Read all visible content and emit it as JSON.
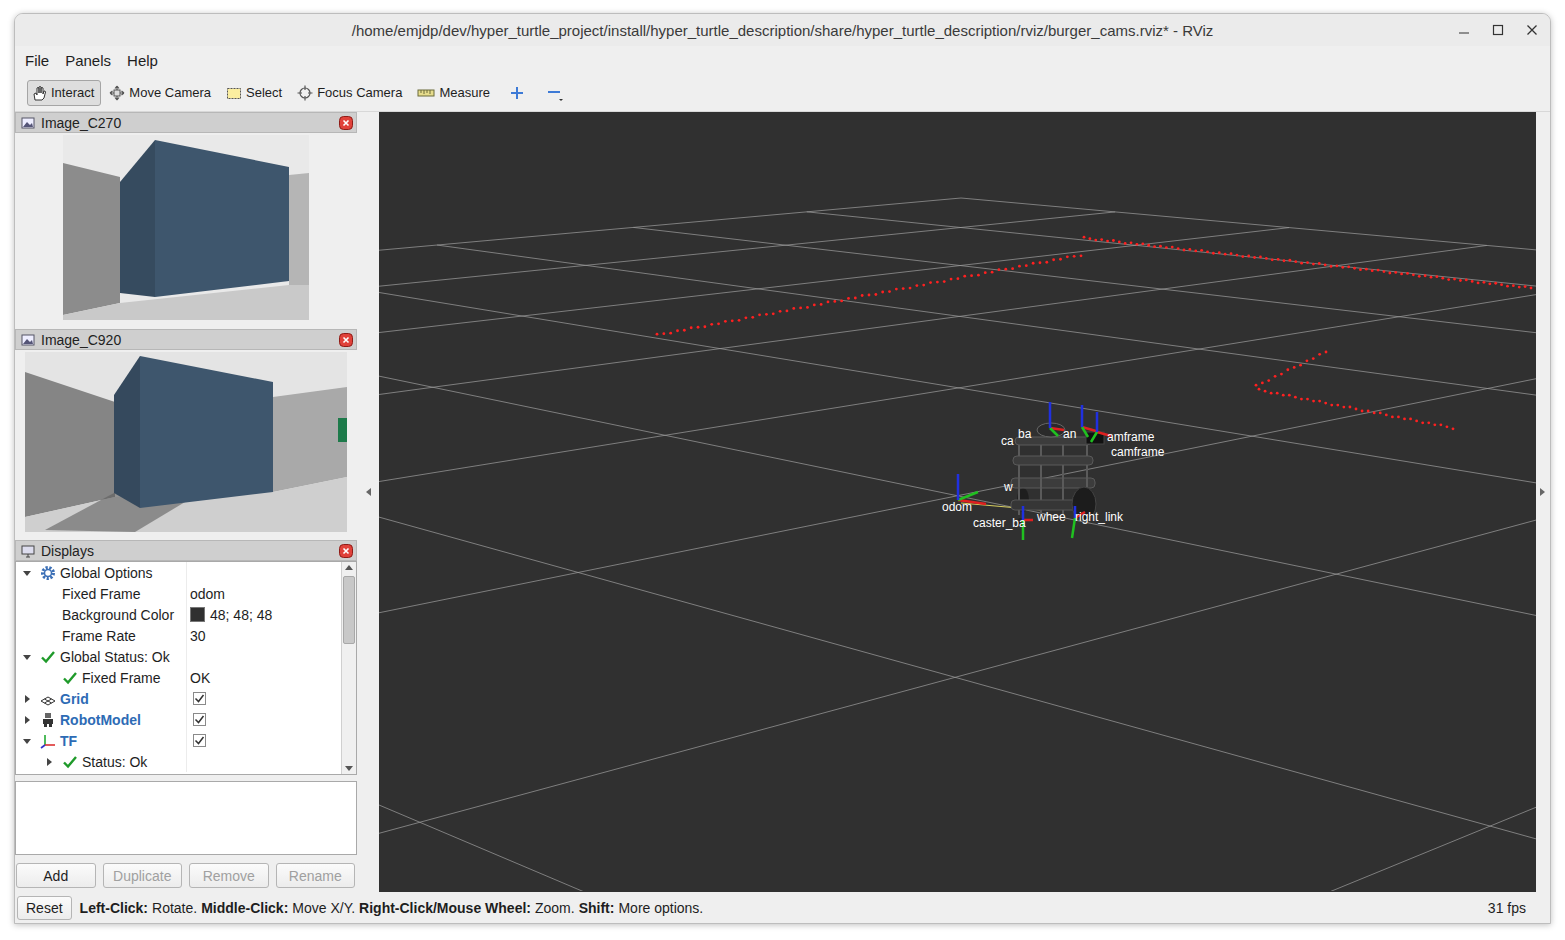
{
  "window": {
    "title": "/home/emjdp/dev/hyper_turtle_project/install/hyper_turtle_description/share/hyper_turtle_description/rviz/burger_cams.rviz* - RViz"
  },
  "menu": [
    "File",
    "Panels",
    "Help"
  ],
  "toolbar": [
    {
      "label": "Interact",
      "selected": true
    },
    {
      "label": "Move Camera",
      "selected": false
    },
    {
      "label": "Select",
      "selected": false
    },
    {
      "label": "Focus Camera",
      "selected": false
    },
    {
      "label": "Measure",
      "selected": false
    }
  ],
  "image_panels": [
    {
      "title": "Image_C270"
    },
    {
      "title": "Image_C920"
    }
  ],
  "displays": {
    "title": "Displays",
    "rows": [
      {
        "label": "Global Options",
        "kind": "options",
        "depth": 0,
        "expandable": true,
        "expanded": true,
        "value": ""
      },
      {
        "label": "Fixed Frame",
        "kind": "property",
        "depth": 1,
        "expandable": false,
        "expanded": false,
        "value": "odom"
      },
      {
        "label": "Background Color",
        "kind": "color",
        "depth": 1,
        "expandable": false,
        "expanded": false,
        "value": "48; 48; 48",
        "swatch": "#303030"
      },
      {
        "label": "Frame Rate",
        "kind": "property",
        "depth": 1,
        "expandable": false,
        "expanded": false,
        "value": "30"
      },
      {
        "label": "Global Status: Ok",
        "kind": "status",
        "depth": 0,
        "expandable": true,
        "expanded": true,
        "value": "",
        "ok": true
      },
      {
        "label": "Fixed Frame",
        "kind": "status",
        "depth": 1,
        "expandable": false,
        "expanded": false,
        "value": "OK",
        "ok": true
      },
      {
        "label": "Grid",
        "kind": "grid",
        "depth": 0,
        "expandable": true,
        "expanded": false,
        "value": "",
        "checked": true
      },
      {
        "label": "RobotModel",
        "kind": "robot-model",
        "depth": 0,
        "expandable": true,
        "expanded": false,
        "value": "",
        "checked": true
      },
      {
        "label": "TF",
        "kind": "tf",
        "depth": 0,
        "expandable": true,
        "expanded": true,
        "value": "",
        "checked": true
      },
      {
        "label": "Status: Ok",
        "kind": "status",
        "depth": 1,
        "expandable": true,
        "expanded": false,
        "value": "",
        "ok": true
      }
    ]
  },
  "buttons": [
    {
      "label": "Add",
      "disabled": false
    },
    {
      "label": "Duplicate",
      "disabled": true
    },
    {
      "label": "Remove",
      "disabled": true
    },
    {
      "label": "Rename",
      "disabled": true
    }
  ],
  "view": {
    "tf_frames": [
      "ca",
      "ba",
      "an",
      "amframe",
      "camframe",
      "w",
      "odom",
      "caster_ba",
      "whee",
      "right_link"
    ]
  },
  "status_bar": {
    "reset": "Reset",
    "hints": [
      {
        "text": "Left-Click:",
        "bold": true
      },
      {
        "text": "Rotate.",
        "bold": false
      },
      {
        "text": "Middle-Click:",
        "bold": true
      },
      {
        "text": "Move X/Y.",
        "bold": false
      },
      {
        "text": "Right-Click/Mouse Wheel:",
        "bold": true
      },
      {
        "text": "Zoom.",
        "bold": false
      },
      {
        "text": "Shift:",
        "bold": true
      },
      {
        "text": "More options.",
        "bold": false
      }
    ],
    "fps": "31 fps"
  }
}
